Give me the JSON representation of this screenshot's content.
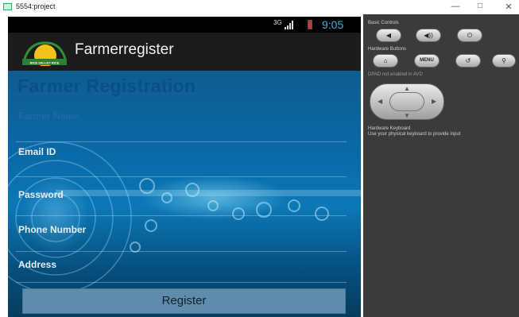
{
  "window": {
    "title": "5554:project",
    "minimize": "—",
    "maximize": "□",
    "close": "✕"
  },
  "status_bar": {
    "network": "3G",
    "time": "9:05"
  },
  "app": {
    "title": "Farmerregister"
  },
  "form": {
    "heading": "Farmer Registration",
    "fields": [
      {
        "label": "Farmer Name",
        "value": ""
      },
      {
        "label": "Email ID",
        "value": ""
      },
      {
        "label": "Password",
        "value": ""
      },
      {
        "label": "Phone Number",
        "value": ""
      },
      {
        "label": "Address",
        "value": ""
      }
    ],
    "register_label": "Register"
  },
  "controls": {
    "basic_label": "Basic Controls",
    "basic_buttons": [
      "volume-down-icon",
      "volume-up-icon",
      "power-icon"
    ],
    "hardware_label": "Hardware Buttons",
    "menu_label": "MENU",
    "dpad_label": "DPAD not enabled in AVD",
    "keyboard_label": "Hardware Keyboard",
    "keyboard_hint": "Use your physical keyboard to provide input"
  },
  "colors": {
    "clock": "#3ab1e3",
    "heading": "#0b4f88",
    "register_button": "#5d8cad"
  }
}
